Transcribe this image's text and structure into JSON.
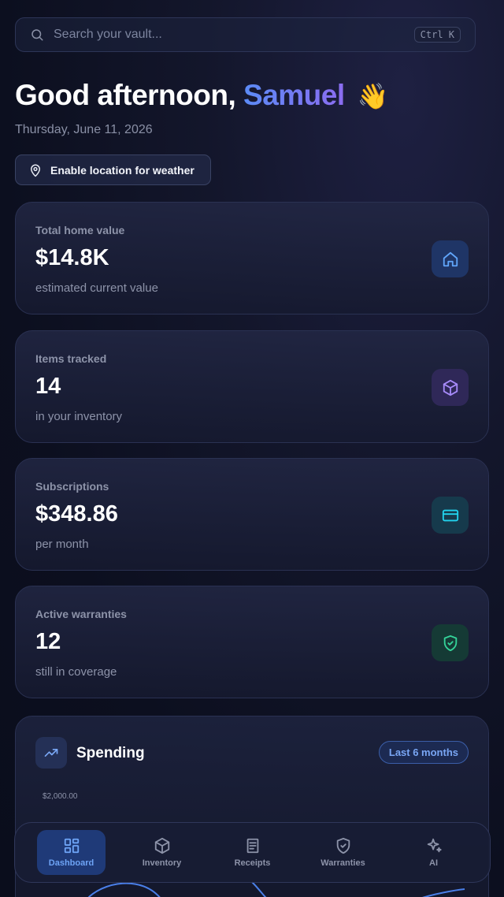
{
  "search": {
    "placeholder": "Search your vault...",
    "shortcut": "Ctrl K"
  },
  "greeting": {
    "prefix": "Good afternoon,",
    "name": "Samuel",
    "emoji": "👋"
  },
  "date": "Thursday, June 11, 2026",
  "location_button": {
    "label": "Enable location for weather",
    "icon": "map-pin-icon"
  },
  "cards": [
    {
      "label": "Total home value",
      "value": "$14.8K",
      "sub": "estimated current value",
      "icon": "home-icon",
      "accent": "#60a5fa"
    },
    {
      "label": "Items tracked",
      "value": "14",
      "sub": "in your inventory",
      "icon": "box-icon",
      "accent": "#a78bfa"
    },
    {
      "label": "Subscriptions",
      "value": "$348.86",
      "sub": "per month",
      "icon": "credit-card-icon",
      "accent": "#22d3ee"
    },
    {
      "label": "Active warranties",
      "value": "12",
      "sub": "still in coverage",
      "icon": "shield-check-icon",
      "accent": "#34d399"
    }
  ],
  "spending": {
    "title": "Spending",
    "range_label": "Last 6 months",
    "icon": "trending-up-icon",
    "y_tick": "$2,000.00"
  },
  "nav": {
    "items": [
      {
        "label": "Dashboard",
        "icon": "grid-icon",
        "active": true
      },
      {
        "label": "Inventory",
        "icon": "box-icon",
        "active": false
      },
      {
        "label": "Receipts",
        "icon": "receipt-icon",
        "active": false
      },
      {
        "label": "Warranties",
        "icon": "shield-check-icon",
        "active": false
      },
      {
        "label": "AI",
        "icon": "sparkles-icon",
        "active": false
      }
    ]
  },
  "colors": {
    "accent_blue": "#5b8bf6",
    "accent_purple": "#8b6cf0",
    "background": "#0c0f1f"
  }
}
